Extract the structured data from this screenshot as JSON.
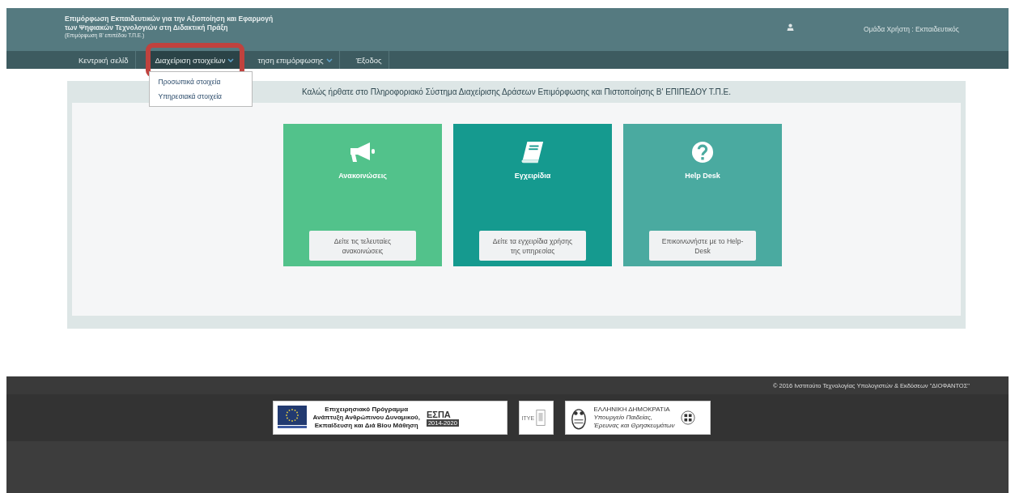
{
  "header": {
    "title_line_1": "Επιμόρφωση Εκπαιδευτικών για την Αξιοποίηση και Εφαρμογή",
    "title_line_2": "των Ψηφιακών Τεχνολογιών στη Διδακτική Πράξη",
    "subtitle": "(Επιμόρφωση Β' επιπέδου Τ.Π.Ε.)",
    "user_group": "Ομάδα Χρήστη : Εκπαιδευτικός"
  },
  "nav": [
    {
      "label": "Κεντρική σελίδ",
      "selected": false,
      "dropdown": false,
      "highlighted": false
    },
    {
      "label": "Διαχείριση στοιχείων",
      "selected": true,
      "dropdown": true,
      "highlighted": true
    },
    {
      "label": "τηση επιμόρφωσης",
      "selected": false,
      "dropdown": true,
      "highlighted": false
    },
    {
      "label": "Έξοδος",
      "selected": false,
      "dropdown": false,
      "highlighted": false
    }
  ],
  "dropdown_menu": [
    "Προσωπικά στοιχεία",
    "Υπηρεσιακά στοιχεία"
  ],
  "welcome": "Καλώς ήρθατε στο Πληροφοριακό Σύστημα Διαχείρισης Δράσεων Επιμόρφωσης και Πιστοποίησης Β' ΕΠΙΠΕΔΟΥ Τ.Π.Ε.",
  "cards": [
    {
      "kind": "megaphone",
      "title": "Ανακοινώσεις",
      "button": "Δείτε τις τελευταίες ανακοινώσεις",
      "color": "#52c28b"
    },
    {
      "kind": "book",
      "title": "Εγχειρίδια",
      "button": "Δείτε τα εγχειρίδια χρήσης της υπηρεσίας",
      "color": "#159a8f"
    },
    {
      "kind": "question",
      "title": "Help Desk",
      "button": "Επικοινωνήστε με το Help-Desk",
      "color": "#4aaaa0"
    }
  ],
  "footer": {
    "copyright": "© 2016 Ινστιτούτο Τεχνολογίας Υπολογιστών & Εκδόσεων \"ΔΙΟΦΑΝΤΟΣ\"",
    "espa_lines": [
      "Επιχειρησιακό Πρόγραμμα",
      "Ανάπτυξη Ανθρώπινου Δυναμικού,",
      "Εκπαίδευση και Διά Βίου Μάθηση"
    ],
    "espa_mark": "ΕΣΠΑ",
    "espa_years": "2014-2020",
    "itye": "ΙΤΥΕ",
    "ministry_lines": [
      "ΕΛΛΗΝΙΚΗ ΔΗΜΟΚΡΑΤΙΑ",
      "Υπουργείο Παιδείας,",
      "Έρευνας και Θρησκευμάτων"
    ]
  }
}
